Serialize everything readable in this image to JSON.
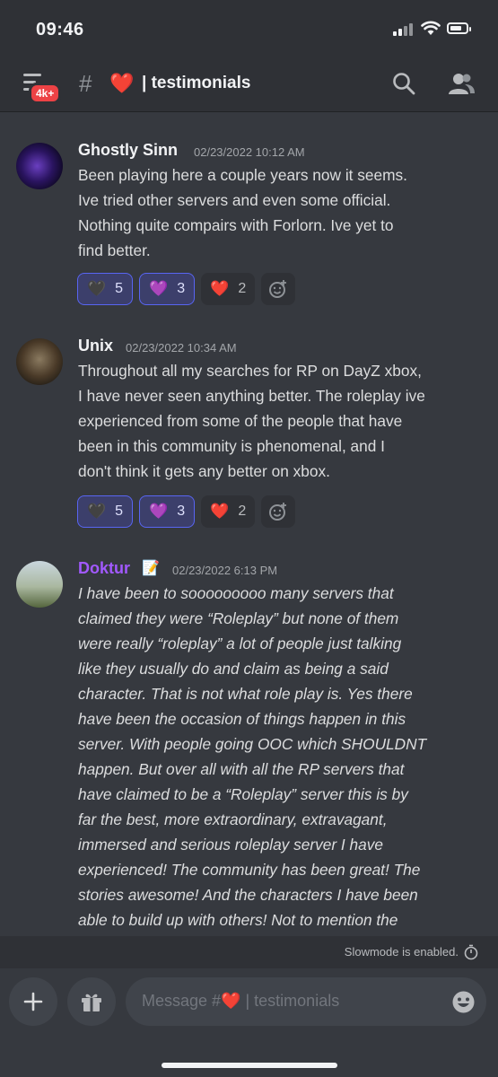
{
  "status_bar": {
    "time": "09:46"
  },
  "header": {
    "badge": "4k+",
    "hash": "#",
    "channel_emoji": "❤️",
    "channel_name": "| testimonials"
  },
  "messages": [
    {
      "author": "Ghostly Sinn",
      "author_color": "#f2f3f5",
      "timestamp": "02/23/2022 10:12 AM",
      "lines": [
        "Been playing here a couple years now it seems.",
        "Ive tried other servers and even some official.",
        "Nothing quite compairs with Forlorn. Ive yet to",
        "find better."
      ],
      "reactions": [
        {
          "emoji": "🖤",
          "count": "5",
          "active": true
        },
        {
          "emoji": "💜",
          "count": "3",
          "active": true
        },
        {
          "emoji": "❤️",
          "count": "2",
          "active": false
        }
      ]
    },
    {
      "author": "Unix",
      "author_color": "#f2f3f5",
      "timestamp": "02/23/2022 10:34 AM",
      "lines": [
        "Throughout all my searches for RP on DayZ xbox,",
        "I have never seen anything better. The roleplay ive",
        "experienced from some of the people that have",
        "been in this community is phenomenal, and I",
        "don't think it gets any better on xbox."
      ],
      "reactions": [
        {
          "emoji": "🖤",
          "count": "5",
          "active": true
        },
        {
          "emoji": "💜",
          "count": "3",
          "active": true
        },
        {
          "emoji": "❤️",
          "count": "2",
          "active": false
        }
      ]
    },
    {
      "author": "Doktur",
      "author_color": "#a259ff",
      "author_emoji": "📝",
      "timestamp": "02/23/2022 6:13 PM",
      "lines": [
        "I have been to sooooooooo many servers that",
        "claimed they were “Roleplay” but none of them",
        "were really “roleplay” a lot of people just talking",
        "like they usually do and claim as being a said",
        "character. That is not what role play is. Yes there",
        "have been the occasion of things happen in this",
        "server. With people going OOC which SHOULDNT",
        "happen. But over all with all the RP servers that",
        "have claimed to be a “Roleplay” server this is by",
        "far the best, more extraordinary, extravagant,",
        "immersed and serious roleplay server I have",
        "experienced! The community has been great! The",
        "stories awesome! And the characters I have been",
        "able to build up with others! Not to mention the"
      ]
    }
  ],
  "slowmode": {
    "text": "Slowmode is enabled."
  },
  "composer": {
    "placeholder_prefix": "Message #",
    "placeholder_emoji": "❤️",
    "placeholder_suffix": " | testimonials"
  },
  "colors": {
    "accent": "#5865f2",
    "badge": "#ed4245",
    "background": "#36393f"
  },
  "icons": [
    "menu-icon",
    "search-icon",
    "members-icon",
    "add-reaction-icon",
    "timer-icon",
    "plus-icon",
    "gift-icon",
    "emoji-icon"
  ]
}
